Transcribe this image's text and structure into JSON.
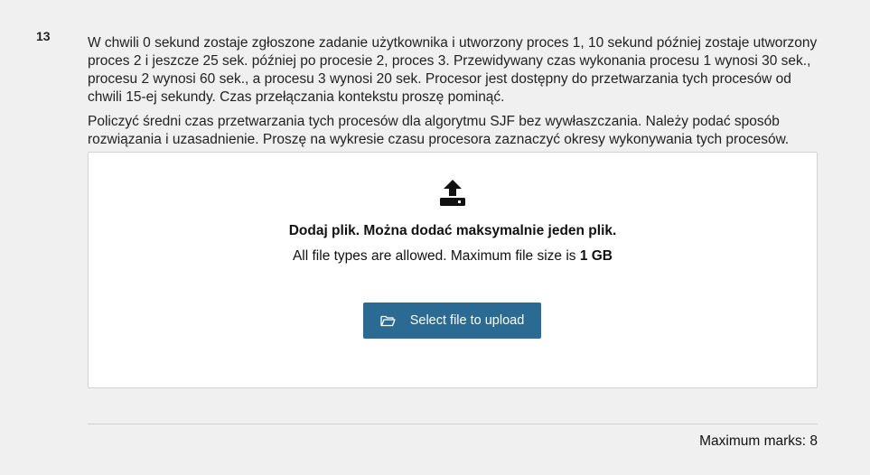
{
  "question": {
    "number": "13",
    "paragraph1": "W chwili 0 sekund zostaje zgłoszone zadanie użytkownika i utworzony proces 1, 10 sekund później zostaje utworzony proces 2 i jeszcze 25 sek. później po procesie 2,  proces 3. Przewidywany czas wykonania procesu 1 wynosi 30 sek., procesu 2 wynosi 60 sek., a procesu 3 wynosi 20 sek. Procesor jest dostępny do przetwarzania tych procesów od chwili 15-ej sekundy. Czas przełączania kontekstu proszę pominąć.",
    "paragraph2": "Policzyć średni czas przetwarzania tych procesów dla algorytmu SJF bez wywłaszczania. Należy podać sposób rozwiązania i uzasadnienie. Proszę na wykresie czasu procesora zaznaczyć okresy wykonywania tych procesów."
  },
  "upload": {
    "icon": "upload-icon",
    "title": "Dodaj plik. Można dodać maksymalnie jeden plik.",
    "info_prefix": "All file types are allowed. Maximum file size is ",
    "max_size": "1 GB",
    "button_icon": "folder-open-icon",
    "button_label": "Select file to upload",
    "button_color": "#2b6a93"
  },
  "footer": {
    "max_marks": "Maximum marks: 8"
  }
}
